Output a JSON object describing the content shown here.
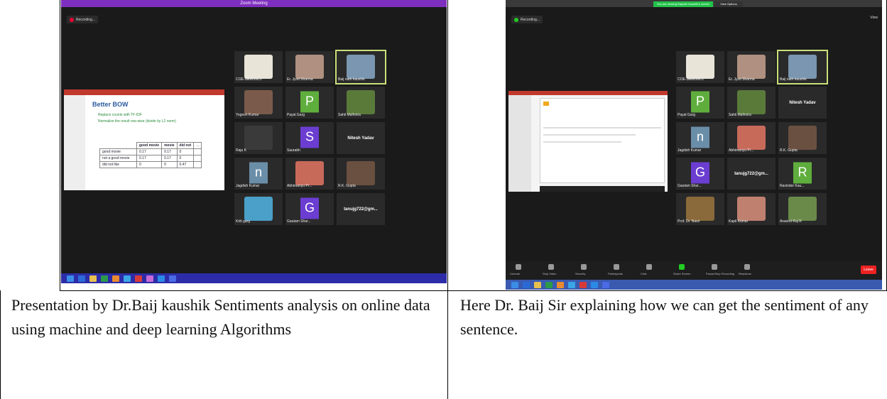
{
  "left_panel": {
    "window_title": "Zoom Meeting",
    "recording_label": "Recording...",
    "slide": {
      "title": "Better BOW",
      "bullets": [
        "Replace counts with TF-IDF",
        "Normalize the result row-wise (divide by L2 norm)"
      ],
      "columns": [
        "good movie",
        "movie",
        "did not",
        "..."
      ],
      "rows": [
        {
          "label": "good movie",
          "values": [
            "0.17",
            "0.17",
            "0",
            ""
          ]
        },
        {
          "label": "not a good movie",
          "values": [
            "0.17",
            "0.17",
            "0",
            ""
          ]
        },
        {
          "label": "did not like",
          "values": [
            "0",
            "0",
            "0.47",
            ""
          ]
        }
      ]
    },
    "participants": [
      {
        "name": "COE-Sikkimtech",
        "letter": "",
        "color": "#e8e4d8"
      },
      {
        "name": "Er. Jyoti Sharma",
        "letter": "",
        "color": "#b09080"
      },
      {
        "name": "Baij nath kaushik",
        "letter": "",
        "color": "#7a96b0"
      },
      {
        "name": "Yogesh Kumar",
        "letter": "",
        "color": "#7a5a4a"
      },
      {
        "name": "Payal Garg",
        "letter": "P",
        "color": "#5fae3d"
      },
      {
        "name": "Sahil Malhotra",
        "letter": "",
        "color": "#5a7a3a"
      },
      {
        "name": "Raju K",
        "letter": "",
        "color": "#3a3a3a"
      },
      {
        "name": "Saurabh",
        "letter": "S",
        "color": "#6b3dd1"
      },
      {
        "name": "Nitesh Yadav",
        "letter": "",
        "color": ""
      },
      {
        "name": "Jagdish Kumar",
        "letter": "n",
        "color": "#6b8ea8"
      },
      {
        "name": "Abhimanyu Pr...",
        "letter": "",
        "color": "#c86a5a"
      },
      {
        "name": "R.K. Gupta",
        "letter": "",
        "color": "#6a5040"
      },
      {
        "name": "Kriti garg",
        "letter": "",
        "color": "#4aa0c8"
      },
      {
        "name": "Gautam Shar...",
        "letter": "G",
        "color": "#6b3dd1"
      },
      {
        "name": "tanujg722@gm...",
        "letter": "",
        "color": ""
      }
    ]
  },
  "right_panel": {
    "banner": "You are viewing Rajnath Kaushik's screen",
    "view_options": "View Options",
    "recording_label": "Recording...",
    "view_label": "View",
    "participants": [
      {
        "name": "COE-Sikkimtech",
        "letter": "",
        "color": "#e8e4d8"
      },
      {
        "name": "Er. Jyoti Sharma",
        "letter": "",
        "color": "#b09080"
      },
      {
        "name": "Baij nath kaushik",
        "letter": "",
        "color": "#7a96b0"
      },
      {
        "name": "Payal Garg",
        "letter": "P",
        "color": "#5fae3d"
      },
      {
        "name": "Sahil Malhotra",
        "letter": "",
        "color": "#5a7a3a"
      },
      {
        "name": "Nitesh Yadav",
        "letter": "",
        "color": ""
      },
      {
        "name": "Jagdish Kumar",
        "letter": "n",
        "color": "#6b8ea8"
      },
      {
        "name": "Abhimanyu Pr...",
        "letter": "",
        "color": "#c86a5a"
      },
      {
        "name": "R.K. Gupta",
        "letter": "",
        "color": "#6a5040"
      },
      {
        "name": "Gautam Shar...",
        "letter": "G",
        "color": "#6b3dd1"
      },
      {
        "name": "tanujg722@gm...",
        "letter": "",
        "color": ""
      },
      {
        "name": "Ravinder Kau...",
        "letter": "R",
        "color": "#5fae3d"
      },
      {
        "name": "Prof. Dr. Nasir",
        "letter": "",
        "color": "#8a6a3a"
      },
      {
        "name": "Kapil Kumar",
        "letter": "",
        "color": "#c08070"
      },
      {
        "name": "Aravind Raj R",
        "letter": "",
        "color": "#6a8a4a"
      }
    ],
    "controls": [
      "Unmute",
      "Stop Video",
      "Security",
      "Participants",
      "Chat",
      "Share Screen",
      "Pause/Stop Recording",
      "Reactions"
    ],
    "leave_label": "Leave"
  },
  "captions": {
    "left": "Presentation by Dr.Baij kaushik Sentiments analysis on online data using machine and deep learning Algorithms",
    "right": "Here Dr. Baij Sir explaining how we can get the sentiment of any sentence."
  }
}
